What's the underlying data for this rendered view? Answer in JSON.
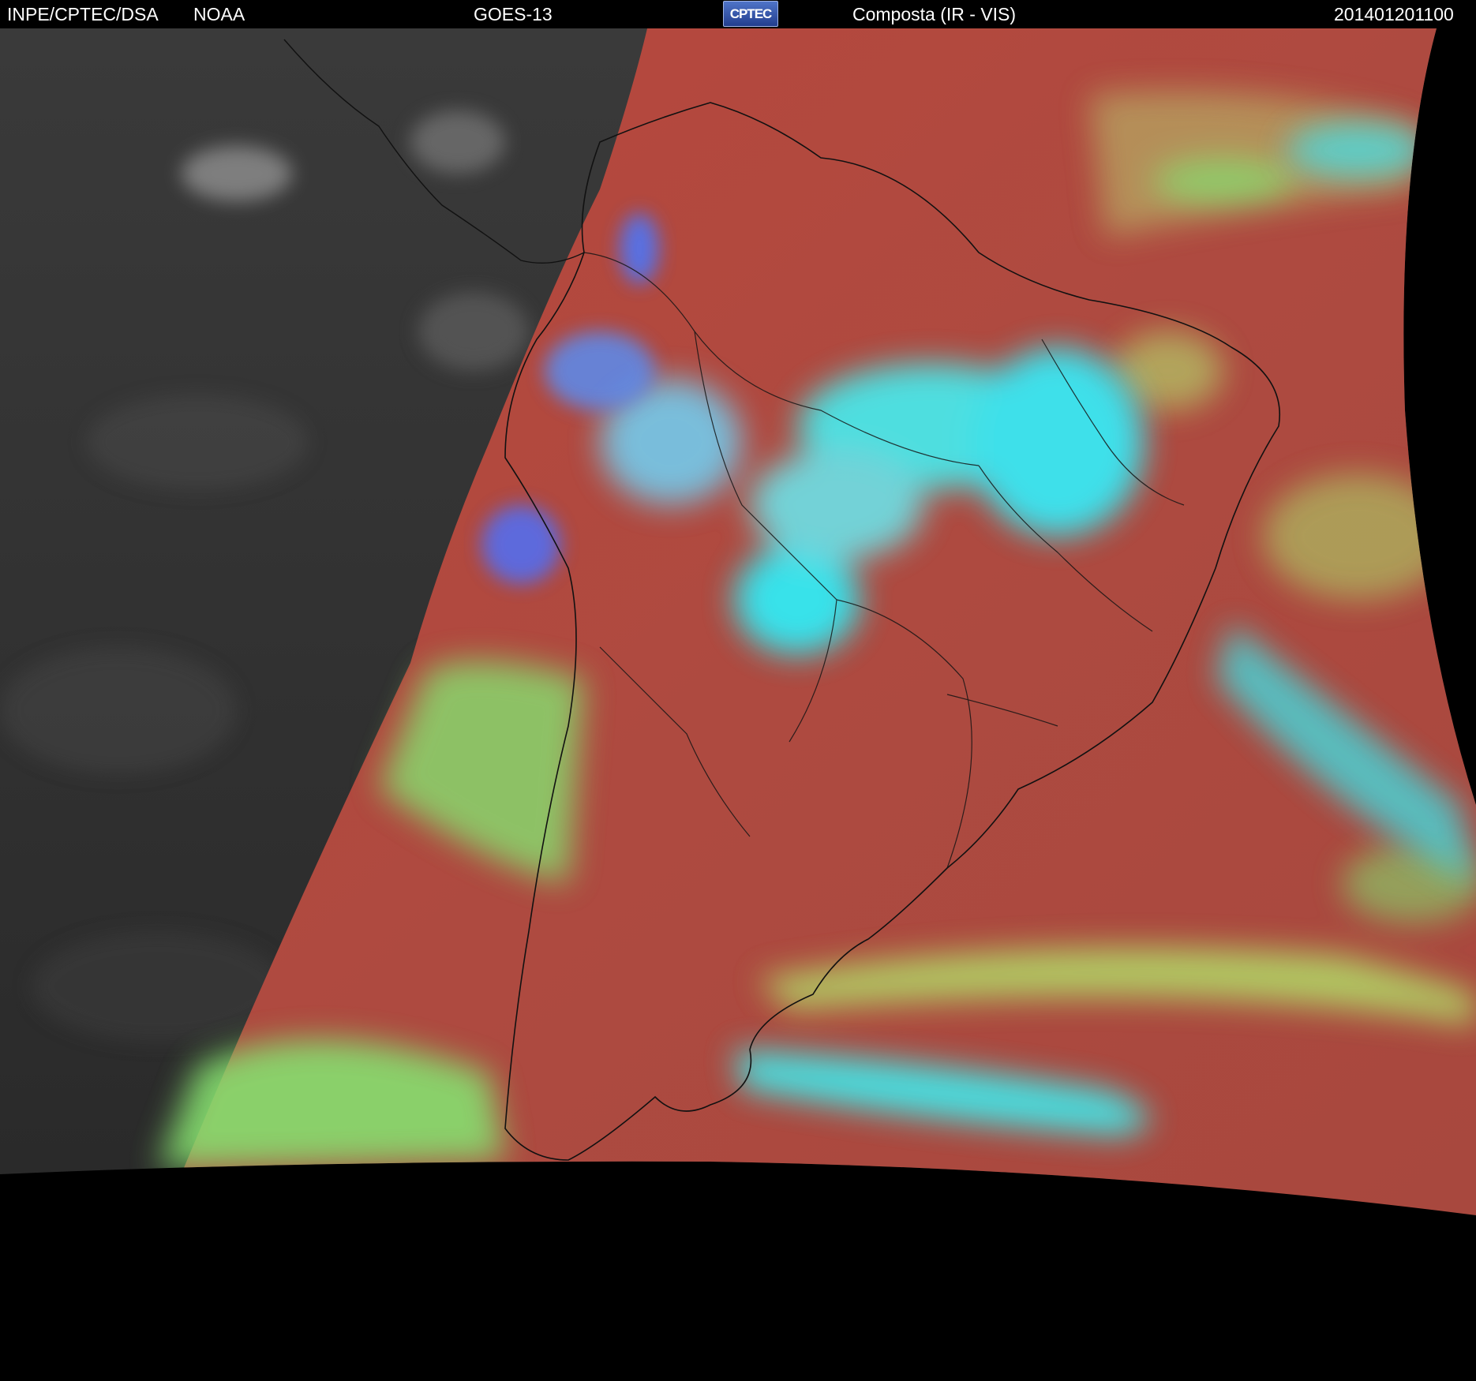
{
  "header": {
    "organization": "INPE/CPTEC/DSA",
    "agency": "NOAA",
    "satellite": "GOES-13",
    "logo_text": "CPTEC",
    "product": "Composta (IR - VIS)",
    "timestamp": "201401201100"
  },
  "colors": {
    "background": "#000000",
    "header_text": "#ffffff",
    "ir_gray": "#333333",
    "land_red": "#b24a3c",
    "cloud_cyan": "#33e6f0",
    "cloud_green": "#8ef06a",
    "cloud_blue": "#4a70ff",
    "border_lines": "#111111"
  }
}
